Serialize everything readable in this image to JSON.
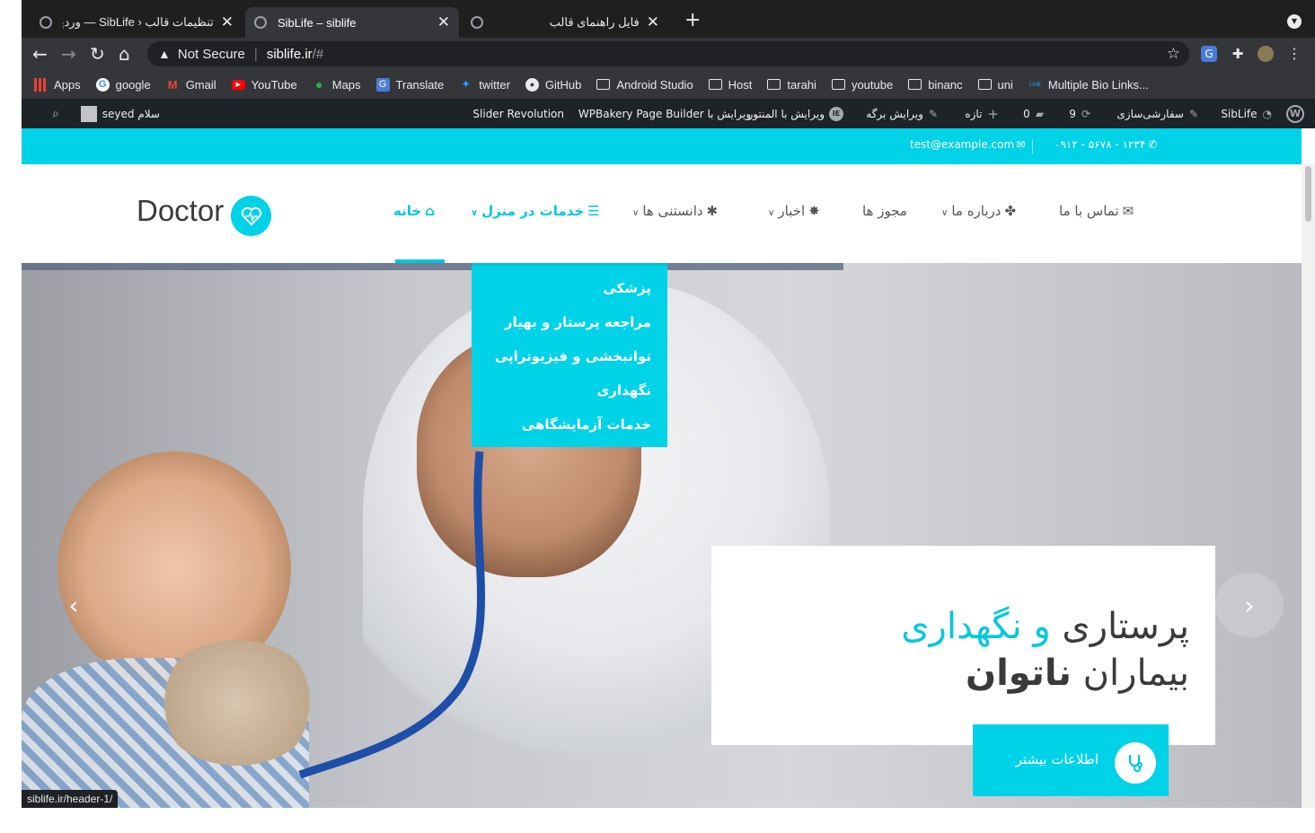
{
  "tabs": [
    {
      "title": "تنظیمات قالب ‹ SibLife — وردپرس",
      "active": false
    },
    {
      "title": "SibLife – siblife",
      "active": true
    },
    {
      "title": "فایل راهنمای قالب",
      "active": false
    }
  ],
  "toolbar": {
    "security": "Not Secure",
    "host": "siblife.ir",
    "path": "/#"
  },
  "bookmarks": [
    {
      "label": "Apps",
      "icon": "apps-grid-icon"
    },
    {
      "label": "google",
      "icon": "google-icon"
    },
    {
      "label": "Gmail",
      "icon": "gmail-icon"
    },
    {
      "label": "YouTube",
      "icon": "youtube-icon"
    },
    {
      "label": "Maps",
      "icon": "maps-pin-icon"
    },
    {
      "label": "Translate",
      "icon": "translate-icon"
    },
    {
      "label": "twitter",
      "icon": "twitter-icon"
    },
    {
      "label": "GitHub",
      "icon": "github-icon"
    },
    {
      "label": "Android Studio",
      "icon": "folder-icon"
    },
    {
      "label": "Host",
      "icon": "folder-icon"
    },
    {
      "label": "tarahi",
      "icon": "folder-icon"
    },
    {
      "label": "youtube",
      "icon": "folder-icon"
    },
    {
      "label": "binanc",
      "icon": "folder-icon"
    },
    {
      "label": "uni",
      "icon": "folder-icon"
    },
    {
      "label": "Multiple Bio Links...",
      "icon": "link-icon"
    }
  ],
  "adminbar": {
    "site": "SibLife",
    "customize": "سفارشی‌سازی",
    "updates": "9",
    "comments": "0",
    "new": "تازه",
    "edit_page": "ویرایش برگه",
    "elementor": "ویرایش با المنتور",
    "wpbakery": "ویرایش با WPBakery Page Builder",
    "slider": "Slider Revolution",
    "greeting": "سلام seyed"
  },
  "topinfo": {
    "phone": "۰۹۱۲ - ۵۶۷۸ - ۱۲۳۴",
    "email": "test@example.com"
  },
  "logo": {
    "text": "Doctor"
  },
  "menu": [
    {
      "label": "خانه",
      "active": true
    },
    {
      "label": "خدمات در منزل",
      "active": false
    },
    {
      "label": "دانستنی ها",
      "active": false
    },
    {
      "label": "اخبار",
      "active": false
    },
    {
      "label": "مجوز ها",
      "active": false
    },
    {
      "label": "درباره ما",
      "active": false
    },
    {
      "label": "تماس با ما",
      "active": false
    }
  ],
  "dropdown": [
    "پزشکی",
    "مراجعه پرستار و بهیار",
    "توانبخشی و فیزیوتراپی",
    "نگهداری",
    "خدمات آزمایشگاهی"
  ],
  "hero": {
    "line1_a": "پرستاری",
    "line1_b": "و",
    "line1_c": "نگهداری",
    "line2_a": "بیماران",
    "line2_b": "ناتوان",
    "button": "اطلاعات بیشتر"
  },
  "statusbar": "siblife.ir/header-1/",
  "colors": {
    "accent": "#00d2e8",
    "adminbar": "#1d2327",
    "chrome_dark": "#35363a"
  }
}
